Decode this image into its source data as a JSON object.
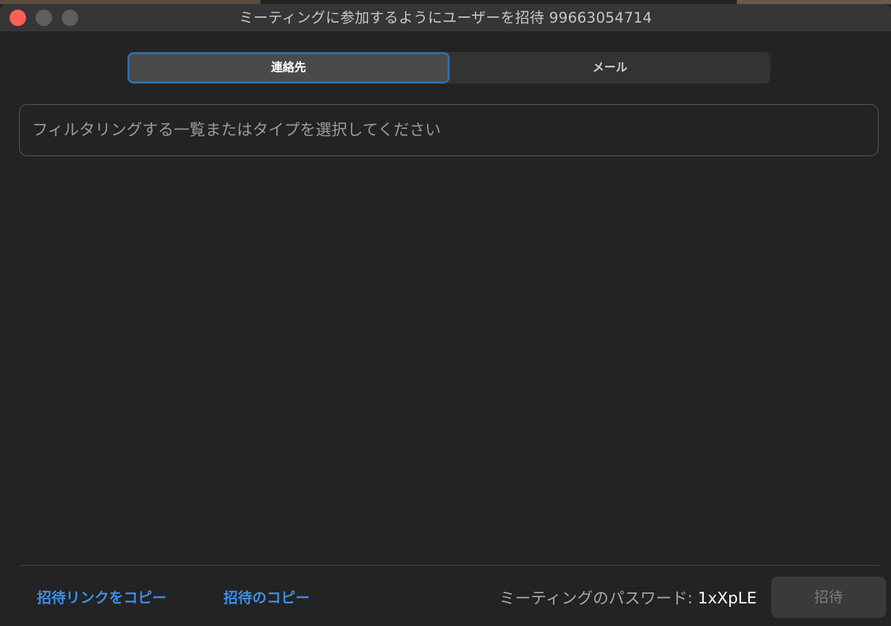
{
  "window": {
    "title": "ミーティングに参加するようにユーザーを招待 99663054714"
  },
  "tabs": {
    "contacts_label": "連絡先",
    "email_label": "メール",
    "selected": "連絡先"
  },
  "search": {
    "placeholder": "フィルタリングする一覧またはタイプを選択してください",
    "value": ""
  },
  "footer": {
    "copy_invite_link_label": "招待リンクをコピー",
    "copy_invitation_label": "招待のコピー",
    "password_label": "ミーティングのパスワード: ",
    "password_value": "1xXpLE",
    "invite_button_label": "招待"
  },
  "colors": {
    "background": "#232323",
    "titlebar": "#363636",
    "accent_link": "#3d8eea",
    "selected_tab_border": "#2f6fa7",
    "close_button": "#fe5f57"
  }
}
